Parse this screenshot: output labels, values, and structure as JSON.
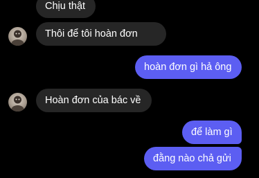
{
  "messages": [
    {
      "id": "m1",
      "direction": "incoming",
      "text": "Chịu thật"
    },
    {
      "id": "m2",
      "direction": "incoming",
      "text": "Thôi để tôi hoàn đơn"
    },
    {
      "id": "m3",
      "direction": "outgoing",
      "text": "hoàn đơn gì hả ông"
    },
    {
      "id": "m4",
      "direction": "incoming",
      "text": "Hoàn đơn của bác về"
    },
    {
      "id": "m5",
      "direction": "outgoing",
      "text": "để làm gì"
    },
    {
      "id": "m6",
      "direction": "outgoing",
      "text": "đằng nào chả gửi"
    }
  ],
  "colors": {
    "background": "#000000",
    "incoming_bubble": "#262626",
    "outgoing_bubble": "#5c5ef2",
    "text": "#ffffff"
  },
  "icons": {
    "avatar": "contact-avatar"
  }
}
